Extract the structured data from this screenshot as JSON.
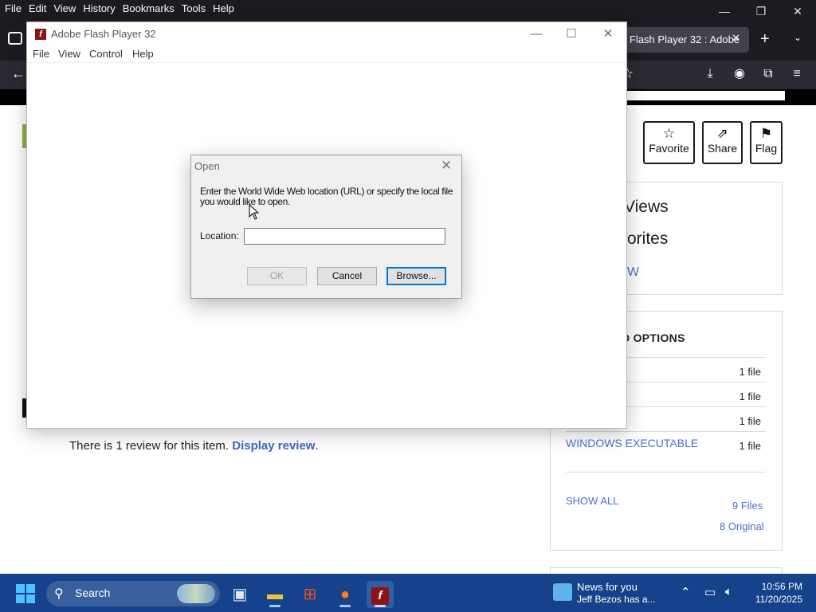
{
  "browser": {
    "menus": [
      "File",
      "Edit",
      "View",
      "History",
      "Bookmarks",
      "Tools",
      "Help"
    ],
    "window_controls": {
      "minimize": "—",
      "maximize": "❐",
      "close": "✕"
    },
    "tab": {
      "title": "Flash Player 32 : Adobe",
      "close": "✕"
    },
    "new_tab": "+",
    "tab_list": "⌄"
  },
  "page": {
    "actions": [
      {
        "label": "Favorite",
        "icon": "star-icon"
      },
      {
        "label": "Share",
        "icon": "share-icon"
      },
      {
        "label": "Flag",
        "icon": "flag-icon"
      }
    ],
    "stats": {
      "views": "Views",
      "favorites": "orites",
      "link": "W"
    },
    "downloads": {
      "title": "D OPTIONS",
      "rows": [
        {
          "name": "",
          "count": "1 file"
        },
        {
          "name": "",
          "count": "1 file"
        },
        {
          "name": "",
          "count": "1 file"
        },
        {
          "name": "WINDOWS EXECUTABLE",
          "count": "1 file"
        }
      ],
      "show_all": "SHOW ALL",
      "files_total": "9 Files",
      "files_original": "8 Original"
    },
    "review": {
      "text": "There is 1 review for this item. ",
      "link": "Display review",
      "suffix": "."
    }
  },
  "flash": {
    "title": "Adobe Flash Player 32",
    "logo": "f",
    "menus": [
      "File",
      "View",
      "Control",
      "Help"
    ],
    "controls": {
      "minimize": "—",
      "maximize": "☐",
      "close": "✕"
    }
  },
  "dialog": {
    "title": "Open",
    "close": "✕",
    "message": "Enter the World Wide Web location (URL) or specify the local file you would like to open.",
    "location_label": "Location:",
    "location_value": "",
    "ok": "OK",
    "cancel": "Cancel",
    "browse": "Browse..."
  },
  "taskbar": {
    "search": "Search",
    "news_title": "News for you",
    "news_sub": "Jeff Bezos has a...",
    "time": "10:56 PM",
    "date": "11/20/2025",
    "colors": {
      "bar": "#15428a",
      "accent": "#4cc2ff"
    }
  }
}
